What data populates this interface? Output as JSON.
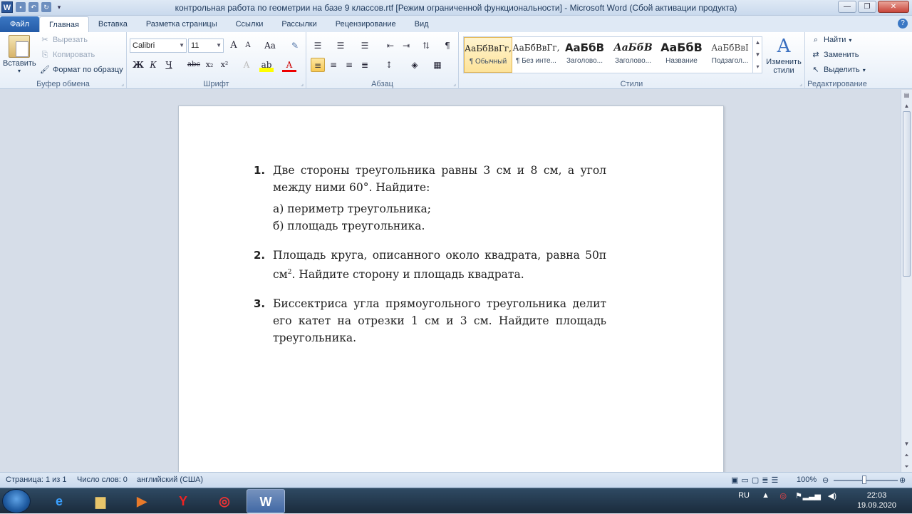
{
  "window": {
    "title": "контрольная работа по геометрии на базе 9 классов.rtf [Режим ограниченной функциональности]  -  Microsoft Word (Сбой активации продукта)",
    "app_icon": "W"
  },
  "tabs": {
    "file": "Файл",
    "items": [
      "Главная",
      "Вставка",
      "Разметка страницы",
      "Ссылки",
      "Рассылки",
      "Рецензирование",
      "Вид"
    ],
    "active": "Главная"
  },
  "ribbon": {
    "clipboard": {
      "label": "Буфер обмена",
      "paste": "Вставить",
      "cut": "Вырезать",
      "copy": "Копировать",
      "format_painter": "Формат по образцу"
    },
    "font": {
      "label": "Шрифт",
      "font_name": "Calibri",
      "font_size": "11",
      "grow": "A",
      "shrink": "A",
      "case": "Aa",
      "bold": "Ж",
      "italic": "К",
      "underline": "Ч",
      "strike": "abc",
      "subscript": "x₂",
      "superscript": "x²"
    },
    "paragraph": {
      "label": "Абзац",
      "pilcrow": "¶"
    },
    "styles": {
      "label": "Стили",
      "items": [
        {
          "sample": "АаБбВвГг,",
          "name": "¶ Обычный"
        },
        {
          "sample": "АаБбВвГг,",
          "name": "¶ Без инте..."
        },
        {
          "sample": "АаБбВ",
          "name": "Заголово..."
        },
        {
          "sample": "АаБбВ",
          "name": "Заголово..."
        },
        {
          "sample": "АаБбВ",
          "name": "Название"
        },
        {
          "sample": "АаБбВвІ",
          "name": "Подзагол..."
        }
      ],
      "change_styles": "Изменить стили"
    },
    "editing": {
      "label": "Редактирование",
      "find": "Найти",
      "replace": "Заменить",
      "select": "Выделить"
    }
  },
  "document": {
    "questions": [
      {
        "num": "1.",
        "text": "Две стороны треугольника равны 3 см и 8 см, а угол между ними 60°. Найдите:",
        "subs": [
          "а)  периметр треугольника;",
          "б)  площадь треугольника."
        ]
      },
      {
        "num": "2.",
        "text_before": "Площадь круга, описанного около квадрата, равна 50π см",
        "sup": "2",
        "text_after": ". Найдите сторону и площадь квадрата."
      },
      {
        "num": "3.",
        "text": "Биссектриса угла прямоугольного треугольника делит его катет на отрезки 1 см и 3 см. Найдите площадь треугольника."
      }
    ]
  },
  "status": {
    "page": "Страница: 1 из 1",
    "words": "Число слов: 0",
    "language": "английский (США)",
    "zoom": "100%"
  },
  "taskbar": {
    "lang": "RU",
    "time": "22:03",
    "date": "19.09.2020"
  }
}
